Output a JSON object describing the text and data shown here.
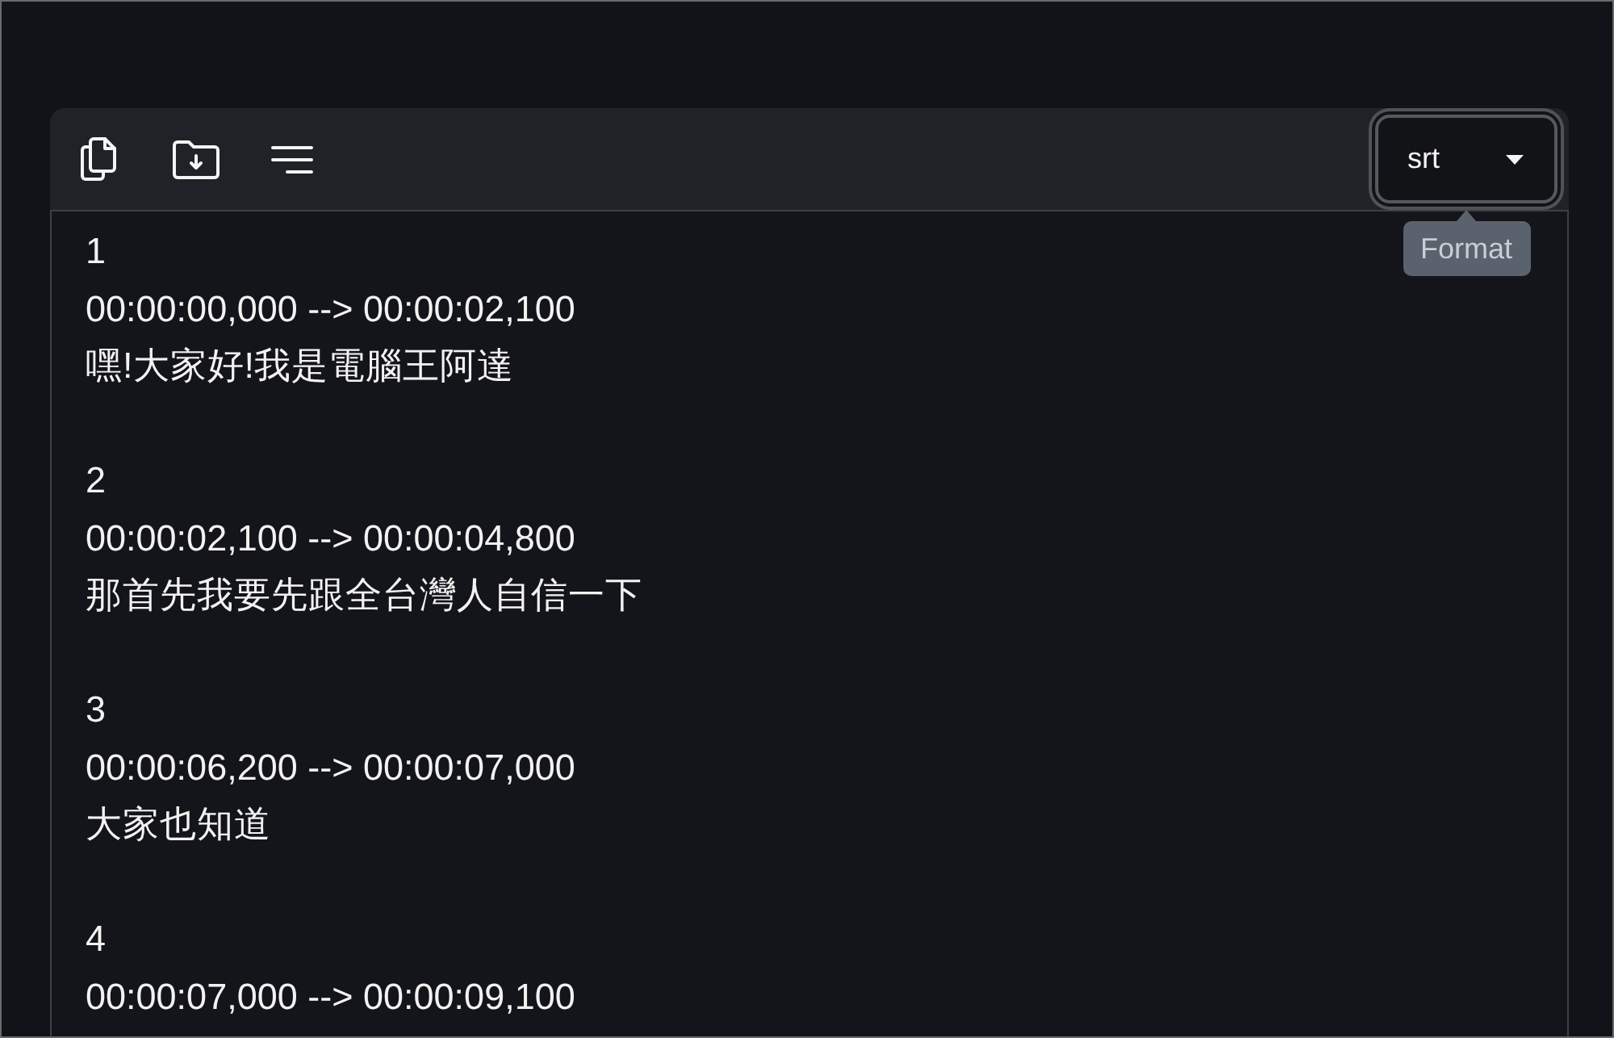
{
  "toolbar": {
    "format_select": {
      "value": "srt",
      "focused": true,
      "tooltip": "Format"
    }
  },
  "subtitles": [
    {
      "index": "1",
      "timing": "00:00:00,000 --> 00:00:02,100",
      "text": "嘿!大家好!我是電腦王阿達"
    },
    {
      "index": "2",
      "timing": "00:00:02,100 --> 00:00:04,800",
      "text": "那首先我要先跟全台灣人自信一下"
    },
    {
      "index": "3",
      "timing": "00:00:06,200 --> 00:00:07,000",
      "text": "大家也知道"
    },
    {
      "index": "4",
      "timing": "00:00:07,000 --> 00:00:09,100"
    }
  ]
}
